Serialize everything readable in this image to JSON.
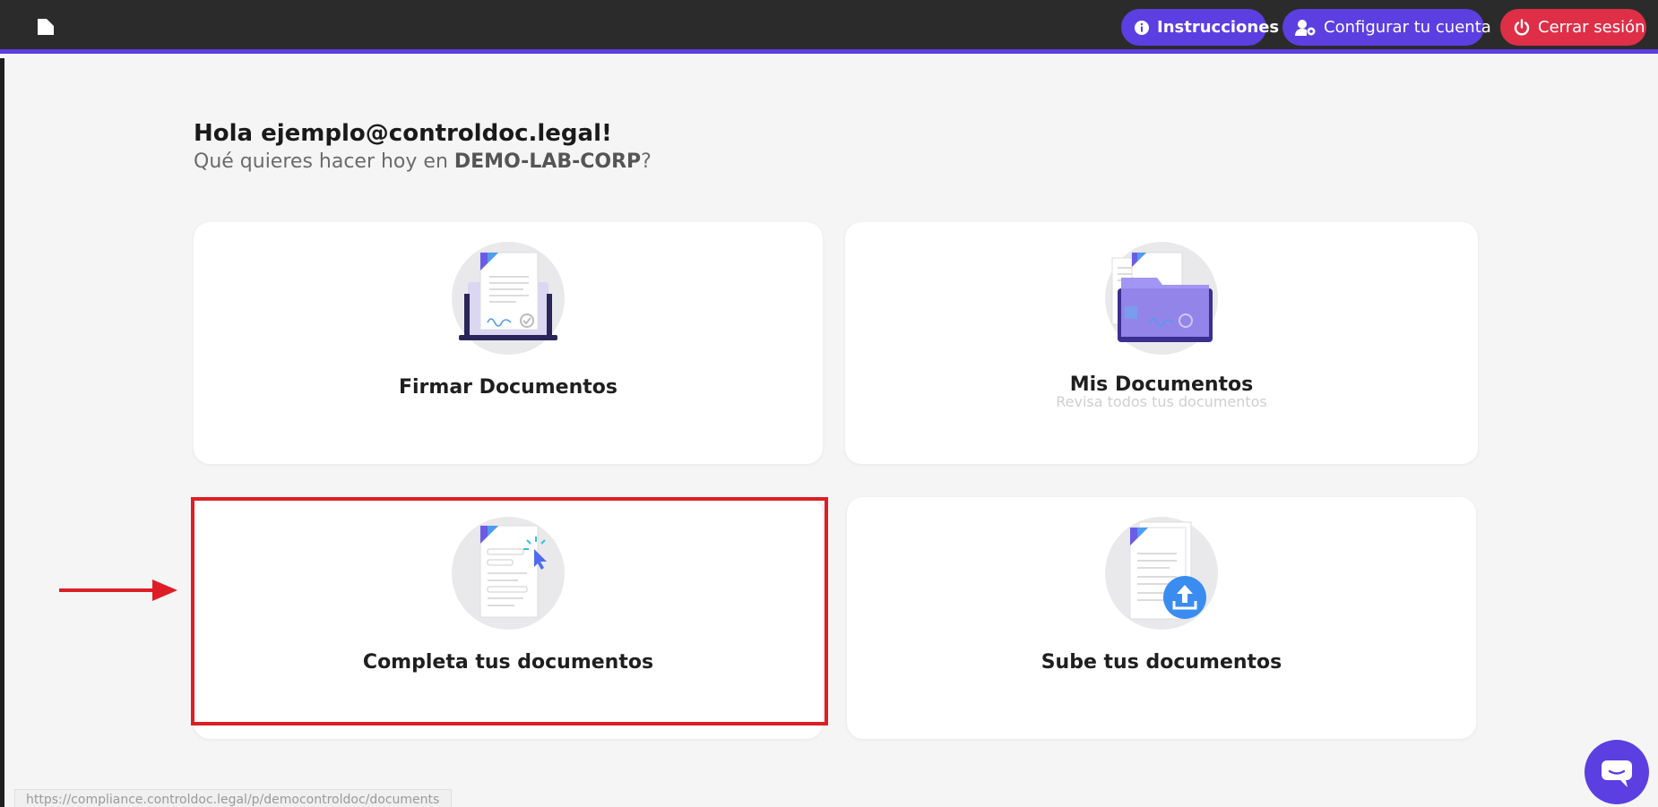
{
  "header": {
    "logo_icon": "document-logo-icon",
    "instructions_label": "Instrucciones",
    "configure_label": "Configurar tu cuenta",
    "logout_label": "Cerrar sesión",
    "accent": "#5b3fe0",
    "danger": "#de2f47"
  },
  "main": {
    "greeting": "Hola ejemplo@controldoc.legal!",
    "subtitle_prefix": "Qué quieres hacer hoy en ",
    "subtitle_org": "DEMO-LAB-CORP",
    "subtitle_suffix": "?"
  },
  "cards": [
    {
      "title": "Firmar Documentos",
      "icon": "sign-document-laptop-icon"
    },
    {
      "title": "Mis Documentos",
      "description": "Revisa todos tus documentos",
      "icon": "document-folder-icon"
    },
    {
      "title": "Completa tus documentos",
      "icon": "fill-form-cursor-icon"
    },
    {
      "title": "Sube tus documentos",
      "icon": "upload-document-icon"
    }
  ],
  "annotation": {
    "highlight_color": "#dd1f25"
  },
  "status_bar": {
    "url": "https://compliance.controldoc.legal/p/democontroldoc/documents"
  }
}
